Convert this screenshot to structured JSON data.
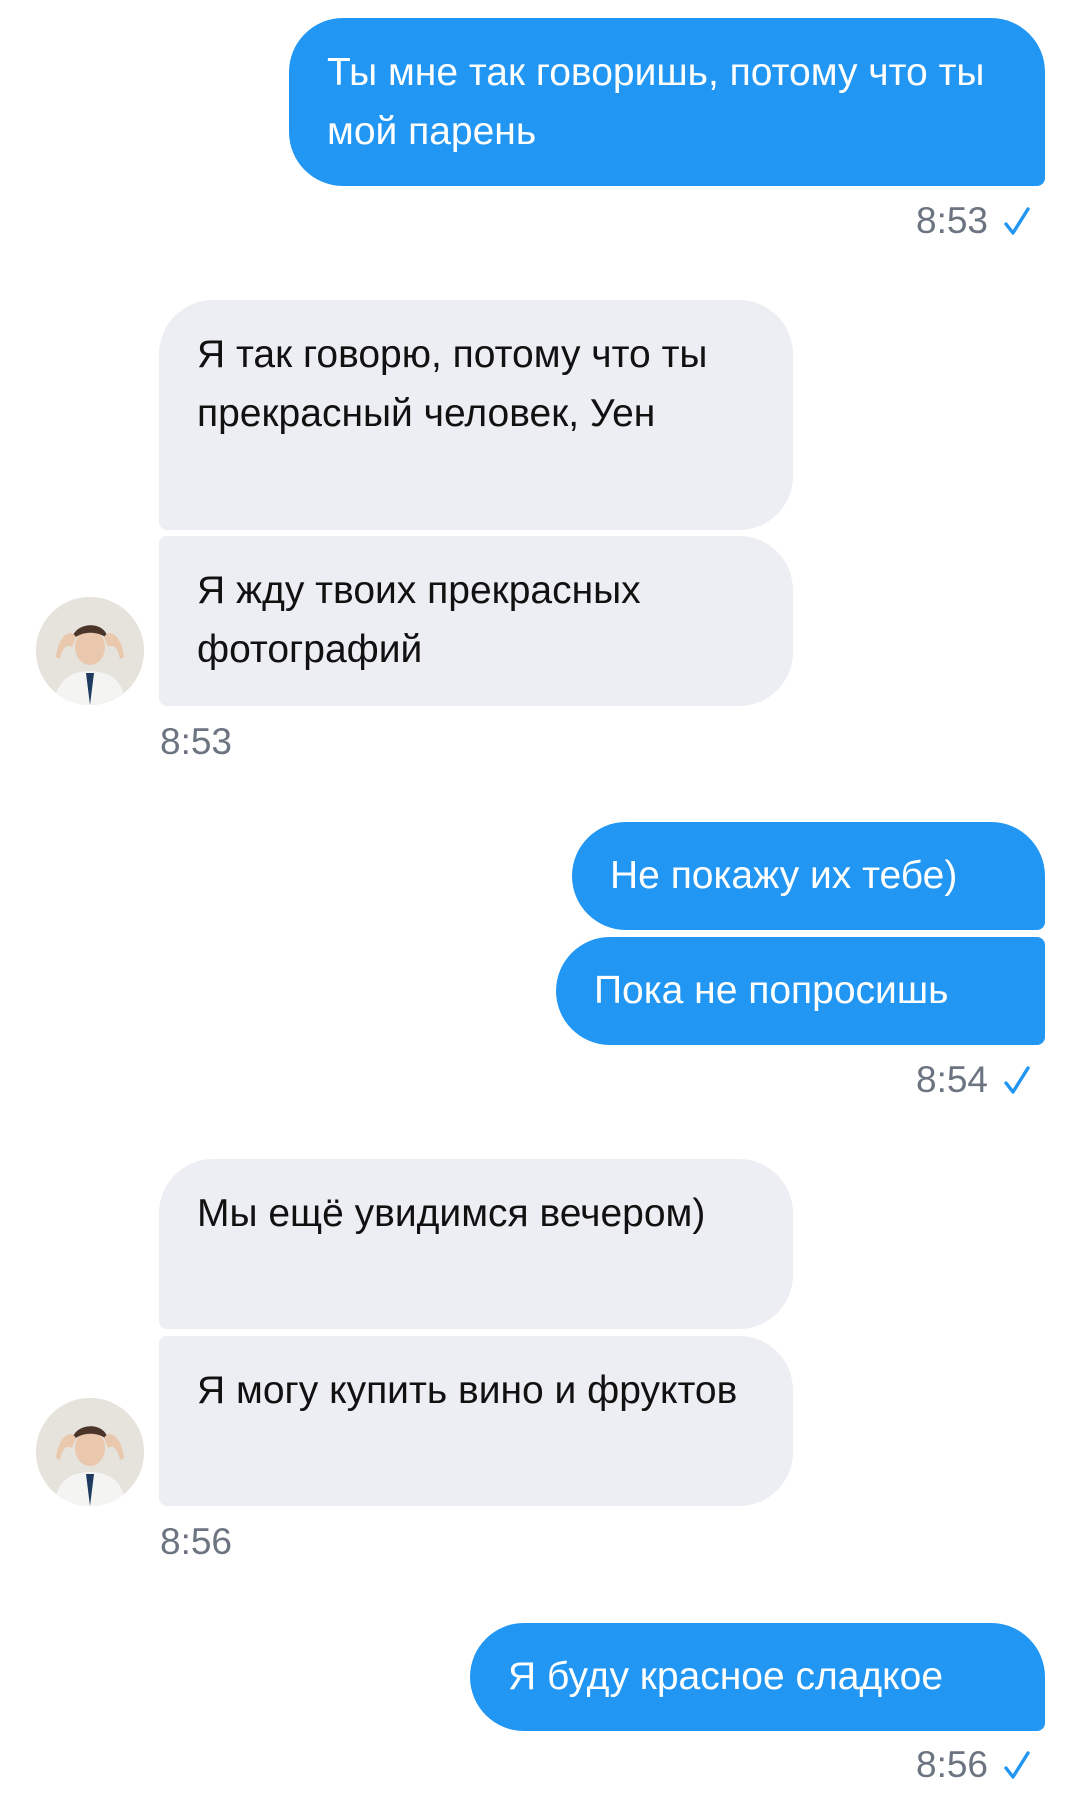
{
  "colors": {
    "outgoing_bubble": "#2196f3",
    "incoming_bubble": "#eceef3",
    "read_check": "#2196f3",
    "timestamp": "#6b7480"
  },
  "messages": [
    {
      "direction": "out",
      "text": "Ты мне так говоришь, потому что ты мой парень"
    },
    {
      "direction": "out",
      "time": "8:53",
      "status": "read-check-icon"
    },
    {
      "direction": "in",
      "text": "Я так говорю, потому что ты прекрасный человек, Уен"
    },
    {
      "direction": "in",
      "text": "Я жду твоих прекрасных фотографий"
    },
    {
      "direction": "in",
      "time": "8:53",
      "avatar": "contact-avatar"
    },
    {
      "direction": "out",
      "text": "Не покажу их тебе)"
    },
    {
      "direction": "out",
      "text": "Пока не попросишь"
    },
    {
      "direction": "out",
      "time": "8:54",
      "status": "read-check-icon"
    },
    {
      "direction": "in",
      "text": "Мы ещё увидимся вечером)"
    },
    {
      "direction": "in",
      "text": "Я могу купить вино и фруктов"
    },
    {
      "direction": "in",
      "time": "8:56",
      "avatar": "contact-avatar"
    },
    {
      "direction": "out",
      "text": "Я буду красное сладкое"
    },
    {
      "direction": "out",
      "time": "8:56",
      "status": "read-check-icon"
    }
  ]
}
